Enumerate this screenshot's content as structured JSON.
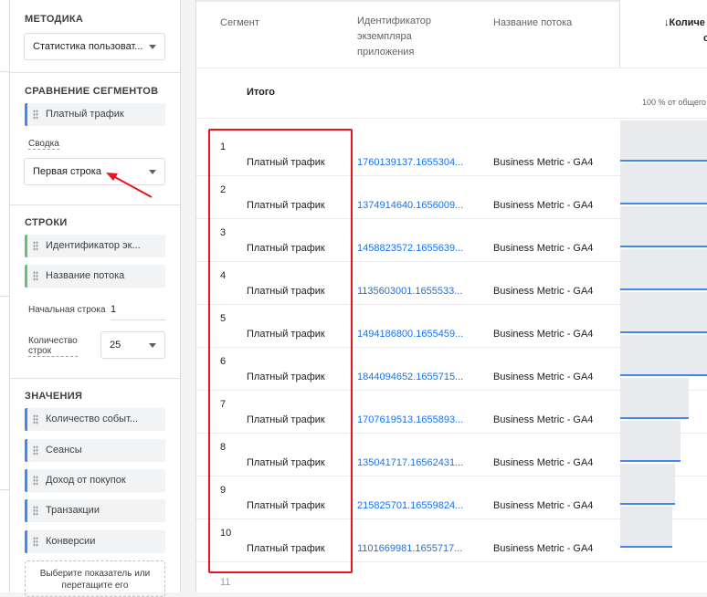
{
  "sidebar": {
    "technique_title": "МЕТОДИКА",
    "technique_value": "Статистика пользоват...",
    "compare_title": "СРАВНЕНИЕ СЕГМЕНТОВ",
    "compare_chip": "Платный трафик",
    "summary_label": "Сводка",
    "summary_value": "Первая строка",
    "rows_title": "СТРОКИ",
    "rows_chips": [
      "Идентификатор эк...",
      "Название потока"
    ],
    "start_row_label": "Начальная строка",
    "start_row_value": "1",
    "row_count_label_1": "Количество",
    "row_count_label_2": "строк",
    "row_count_value": "25",
    "values_title": "ЗНАЧЕНИЯ",
    "values_chips": [
      "Количество событ...",
      "Сеансы",
      "Доход от покупок",
      "Транзакции",
      "Конверсии"
    ],
    "add_metric_1": "Выберите показатель или",
    "add_metric_2": "перетащите его"
  },
  "table": {
    "headers": {
      "segment": "Сегмент",
      "app_id_1": "Идентификатор",
      "app_id_2": "экземпляра",
      "app_id_3": "приложения",
      "stream": "Название потока",
      "metric_1": "↓Количе",
      "metric_2": "соб"
    },
    "total_label": "Итого",
    "total_pct": "100 % от общего",
    "rows": [
      {
        "n": "1",
        "segment": "Платный трафик",
        "id": "1760139137.1655304...",
        "stream": "Business Metric - GA4",
        "bar": 1.0
      },
      {
        "n": "2",
        "segment": "Платный трафик",
        "id": "1374914640.1656009...",
        "stream": "Business Metric - GA4",
        "bar": 1.0
      },
      {
        "n": "3",
        "segment": "Платный трафик",
        "id": "1458823572.1655639...",
        "stream": "Business Metric - GA4",
        "bar": 1.0
      },
      {
        "n": "4",
        "segment": "Платный трафик",
        "id": "1135603001.1655533...",
        "stream": "Business Metric - GA4",
        "bar": 1.0
      },
      {
        "n": "5",
        "segment": "Платный трафик",
        "id": "1494186800.1655459...",
        "stream": "Business Metric - GA4",
        "bar": 1.0
      },
      {
        "n": "6",
        "segment": "Платный трафик",
        "id": "1844094652.1655715...",
        "stream": "Business Metric - GA4",
        "bar": 1.0
      },
      {
        "n": "7",
        "segment": "Платный трафик",
        "id": "1707619513.1655893...",
        "stream": "Business Metric - GA4",
        "bar": 0.78
      },
      {
        "n": "8",
        "segment": "Платный трафик",
        "id": "135041717.16562431...",
        "stream": "Business Metric - GA4",
        "bar": 0.69
      },
      {
        "n": "9",
        "segment": "Платный трафик",
        "id": "215825701.16559824...",
        "stream": "Business Metric - GA4",
        "bar": 0.62
      },
      {
        "n": "10",
        "segment": "Платный трафик",
        "id": "1101669981.1655717...",
        "stream": "Business Metric - GA4",
        "bar": 0.59
      }
    ],
    "next_row_n": "11"
  }
}
